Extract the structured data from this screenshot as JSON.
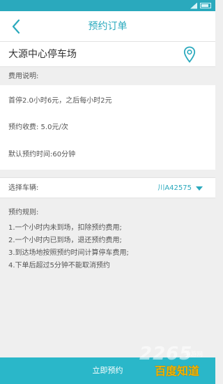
{
  "colors": {
    "accent": "#2aa9bd",
    "button": "#2ab7c9",
    "bg": "#efefef"
  },
  "header": {
    "title": "预约订单",
    "back_icon": "chevron-left-icon"
  },
  "parking": {
    "name": "大源中心停车场",
    "icon": "map-pin-icon"
  },
  "fees": {
    "title": "费用说明:",
    "lines": [
      "首停2.0小时6元，之后每小时2元",
      "预约收费:  5.0元/次",
      "默认预约时间:60分钟"
    ]
  },
  "vehicle": {
    "label": "选择车辆:",
    "plate": "川A42575"
  },
  "rules": {
    "title": "预约规则:",
    "items": [
      "1.一个小时内未到场，扣除预约费用;",
      "2.一个小时内已到场，退还预约费用;",
      "3.到达场地按照预约时间计算停车费用;",
      "4.下单后超过5分钟不能取消预约"
    ]
  },
  "footer": {
    "submit_label": "立即预约"
  },
  "watermarks": {
    "site_number": "2265",
    "site_tag": "手游网",
    "baidu": "百度知道"
  }
}
